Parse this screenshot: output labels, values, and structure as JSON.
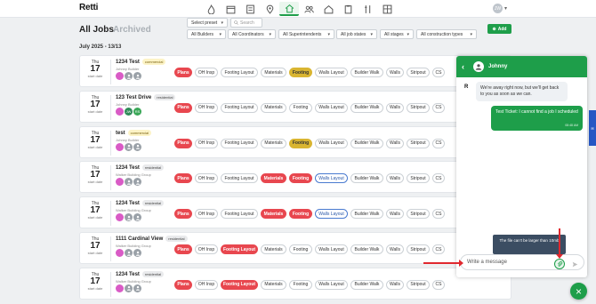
{
  "app": {
    "logo": "Retti",
    "logo_prefix": "",
    "brand_color": "#1e9e4a",
    "user_initials": "JW"
  },
  "nav_icons": [
    "flame-icon",
    "calendar-icon",
    "checklist-icon",
    "map-pin-icon",
    "home-icon",
    "people-icon",
    "house-icon",
    "clipboard-icon",
    "tools-icon",
    "grid-icon"
  ],
  "header": {
    "title": "All Jobs",
    "archived": "Archived",
    "select_preset": "Select preset",
    "search_placeholder": "Search",
    "add_label": "Add",
    "filters": [
      "All Builders",
      "All Coordinators",
      "All Superintendents",
      "All job states",
      "All stages",
      "All construction types"
    ],
    "date_range": "July 2025 - 13/13"
  },
  "jobs": [
    {
      "dow": "Thu",
      "day": "17",
      "sub": "start date",
      "name": "1234 Test",
      "tag": "commercial",
      "builder": "Johnny Builder",
      "avatars": [
        {
          "t": "",
          "c": "#d95bc6"
        },
        {
          "t": "",
          "c": "#9aa1a8"
        },
        {
          "t": "",
          "c": "#9aa1a8"
        }
      ],
      "stages": [
        {
          "l": "Plans",
          "s": "red"
        },
        {
          "l": "OH Insp",
          "s": ""
        },
        {
          "l": "Footing Layout",
          "s": ""
        },
        {
          "l": "Materials",
          "s": ""
        },
        {
          "l": "Footing",
          "s": "yellow"
        },
        {
          "l": "Walls Layout",
          "s": ""
        },
        {
          "l": "Builder Walk",
          "s": ""
        },
        {
          "l": "Walls",
          "s": ""
        },
        {
          "l": "Stripout",
          "s": ""
        },
        {
          "l": "CS",
          "s": ""
        }
      ]
    },
    {
      "dow": "Thu",
      "day": "17",
      "sub": "start date",
      "name": "123 Test Drive",
      "tag": "residential",
      "builder": "Johnny Builder",
      "avatars": [
        {
          "t": "",
          "c": "#d95bc6"
        },
        {
          "t": "JW",
          "c": "#2e8b57"
        },
        {
          "t": "RS",
          "c": "#3aa757"
        }
      ],
      "stages": [
        {
          "l": "Plans",
          "s": "red"
        },
        {
          "l": "OH Insp",
          "s": ""
        },
        {
          "l": "Footing Layout",
          "s": ""
        },
        {
          "l": "Materials",
          "s": ""
        },
        {
          "l": "Footing",
          "s": ""
        },
        {
          "l": "Walls Layout",
          "s": ""
        },
        {
          "l": "Builder Walk",
          "s": ""
        },
        {
          "l": "Walls",
          "s": ""
        },
        {
          "l": "Stripout",
          "s": ""
        },
        {
          "l": "CS",
          "s": ""
        }
      ]
    },
    {
      "dow": "Thu",
      "day": "17",
      "sub": "start date",
      "name": "test",
      "tag": "commercial",
      "builder": "Johnny Builder",
      "avatars": [
        {
          "t": "",
          "c": "#d95bc6"
        },
        {
          "t": "",
          "c": "#9aa1a8"
        },
        {
          "t": "",
          "c": "#9aa1a8"
        }
      ],
      "stages": [
        {
          "l": "Plans",
          "s": "red"
        },
        {
          "l": "OH Insp",
          "s": ""
        },
        {
          "l": "Footing Layout",
          "s": ""
        },
        {
          "l": "Materials",
          "s": ""
        },
        {
          "l": "Footing",
          "s": "yellow"
        },
        {
          "l": "Walls Layout",
          "s": ""
        },
        {
          "l": "Builder Walk",
          "s": ""
        },
        {
          "l": "Walls",
          "s": ""
        },
        {
          "l": "Stripout",
          "s": ""
        },
        {
          "l": "CS",
          "s": ""
        }
      ]
    },
    {
      "dow": "Thu",
      "day": "17",
      "sub": "start date",
      "name": "1234 Test",
      "tag": "residential",
      "builder": "Walker Building Group",
      "avatars": [
        {
          "t": "",
          "c": "#d95bc6"
        },
        {
          "t": "",
          "c": "#9aa1a8"
        },
        {
          "t": "",
          "c": "#9aa1a8"
        }
      ],
      "stages": [
        {
          "l": "Plans",
          "s": "red"
        },
        {
          "l": "OH Insp",
          "s": ""
        },
        {
          "l": "Footing Layout",
          "s": ""
        },
        {
          "l": "Materials",
          "s": "red"
        },
        {
          "l": "Footing",
          "s": "red"
        },
        {
          "l": "Walls Layout",
          "s": "outline"
        },
        {
          "l": "Builder Walk",
          "s": ""
        },
        {
          "l": "Walls",
          "s": ""
        },
        {
          "l": "Stripout",
          "s": ""
        },
        {
          "l": "CS",
          "s": ""
        }
      ]
    },
    {
      "dow": "Thu",
      "day": "17",
      "sub": "start date",
      "name": "1234 Test",
      "tag": "residential",
      "builder": "Walker Building Group",
      "avatars": [
        {
          "t": "",
          "c": "#d95bc6"
        },
        {
          "t": "",
          "c": "#9aa1a8"
        },
        {
          "t": "",
          "c": "#9aa1a8"
        }
      ],
      "stages": [
        {
          "l": "Plans",
          "s": "red"
        },
        {
          "l": "OH Insp",
          "s": ""
        },
        {
          "l": "Footing Layout",
          "s": ""
        },
        {
          "l": "Materials",
          "s": "red"
        },
        {
          "l": "Footing",
          "s": "red"
        },
        {
          "l": "Walls Layout",
          "s": "outline"
        },
        {
          "l": "Builder Walk",
          "s": ""
        },
        {
          "l": "Walls",
          "s": ""
        },
        {
          "l": "Stripout",
          "s": ""
        },
        {
          "l": "CS",
          "s": ""
        }
      ]
    },
    {
      "dow": "Thu",
      "day": "17",
      "sub": "start date",
      "name": "1111 Cardinal View",
      "tag": "residential",
      "builder": "Walker Building Group",
      "avatars": [
        {
          "t": "",
          "c": "#d95bc6"
        },
        {
          "t": "",
          "c": "#9aa1a8"
        },
        {
          "t": "",
          "c": "#9aa1a8"
        }
      ],
      "stages": [
        {
          "l": "Plans",
          "s": "red"
        },
        {
          "l": "OH Insp",
          "s": ""
        },
        {
          "l": "Footing Layout",
          "s": "red"
        },
        {
          "l": "Materials",
          "s": ""
        },
        {
          "l": "Footing",
          "s": ""
        },
        {
          "l": "Walls Layout",
          "s": ""
        },
        {
          "l": "Builder Walk",
          "s": ""
        },
        {
          "l": "Walls",
          "s": ""
        },
        {
          "l": "Stripout",
          "s": ""
        },
        {
          "l": "CS",
          "s": ""
        }
      ]
    },
    {
      "dow": "Thu",
      "day": "17",
      "sub": "start date",
      "name": "1234 Test",
      "tag": "residential",
      "builder": "Walker Building Group",
      "avatars": [
        {
          "t": "",
          "c": "#d95bc6"
        },
        {
          "t": "",
          "c": "#9aa1a8"
        },
        {
          "t": "",
          "c": "#9aa1a8"
        }
      ],
      "stages": [
        {
          "l": "Plans",
          "s": "red"
        },
        {
          "l": "OH Insp",
          "s": ""
        },
        {
          "l": "Footing Layout",
          "s": "red"
        },
        {
          "l": "Materials",
          "s": ""
        },
        {
          "l": "Footing",
          "s": ""
        },
        {
          "l": "Walls Layout",
          "s": ""
        },
        {
          "l": "Builder Walk",
          "s": ""
        },
        {
          "l": "Walls",
          "s": ""
        },
        {
          "l": "Stripout",
          "s": ""
        },
        {
          "l": "CS",
          "s": ""
        }
      ]
    }
  ],
  "chat": {
    "contact": "Johnny",
    "incoming": "We're away right now, but we'll get back to you as soon as we can.",
    "outgoing": "Test Ticket: I cannot find a job I scheduled",
    "time": "08:48 AM",
    "tooltip": "The file can't be larger than 10mb",
    "placeholder": "Write a message"
  }
}
